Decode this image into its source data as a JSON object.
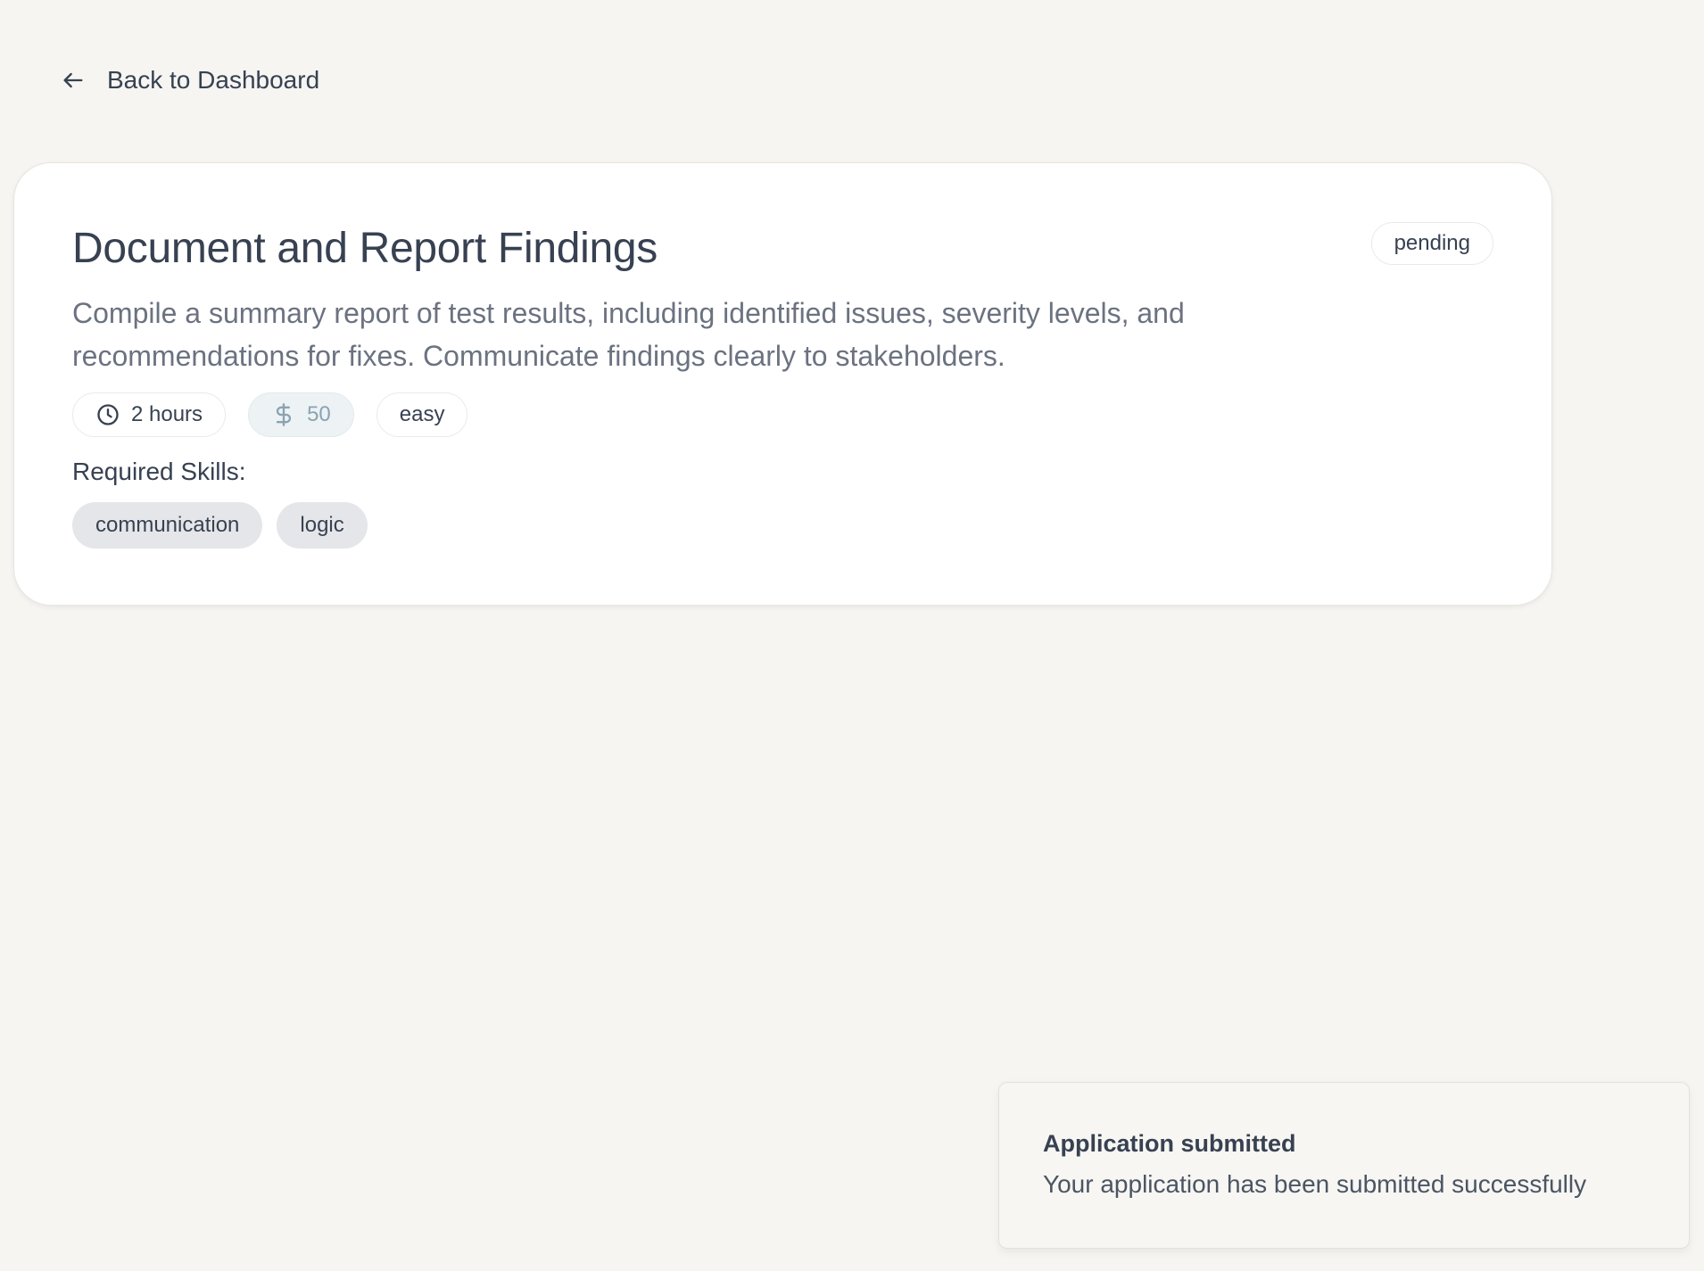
{
  "nav": {
    "back_label": "Back to Dashboard"
  },
  "task": {
    "title": "Document and Report Findings",
    "status": "pending",
    "description": "Compile a summary report of test results, including identified issues, severity levels, and recommendations for fixes. Communicate findings clearly to stakeholders.",
    "duration": "2 hours",
    "reward": "50",
    "difficulty": "easy",
    "skills_label": "Required Skills:",
    "skills": [
      "communication",
      "logic"
    ]
  },
  "toast": {
    "title": "Application submitted",
    "message": "Your application has been submitted successfully"
  },
  "icons": {
    "back": "arrow-left-icon",
    "duration": "clock-icon",
    "reward": "dollar-icon"
  },
  "colors": {
    "background": "#f6f5f2",
    "card": "#ffffff",
    "text": "#374151",
    "muted_text": "#6b7280",
    "reward_pill_bg": "#edf2f5",
    "reward_pill_text": "#8aa3b1",
    "skill_tag_bg": "#e5e6e9"
  }
}
